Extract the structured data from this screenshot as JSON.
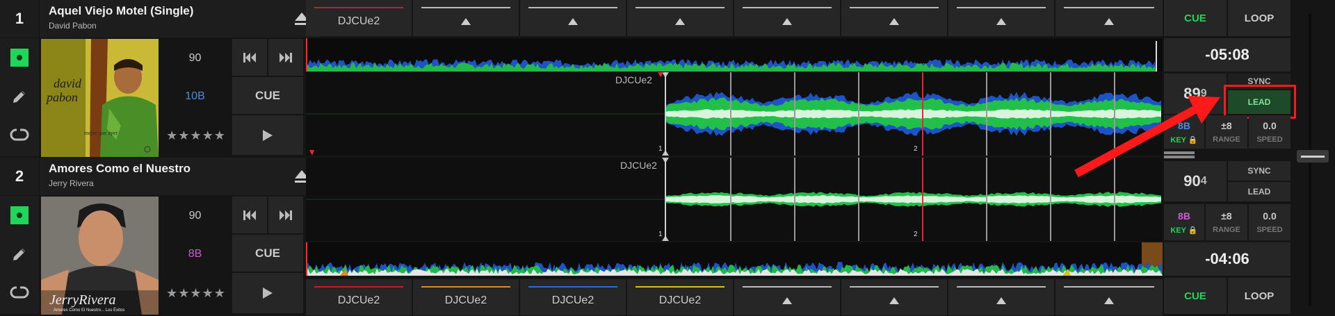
{
  "deck1": {
    "number": "1",
    "title": "Aquel Viejo Motel (Single)",
    "artist": "David Pabon",
    "bpm": "90",
    "key": "10B",
    "stars": "★★★★★",
    "cue_label": "CUE",
    "waveform_cue_label": "DJCUe2",
    "beat_marker_1": "1",
    "beat_marker_2": "2",
    "time_remaining": "-05:08",
    "bpm_display": "89",
    "bpm_decimal": "9",
    "key_display": "8B",
    "key_lock_label": "KEY",
    "range_value": "±8",
    "range_label": "RANGE",
    "speed_value": "0.0",
    "speed_label": "SPEED",
    "sync_label": "SYNC",
    "lead_label": "LEAD",
    "cue_button": "CUE",
    "loop_button": "LOOP",
    "hotcue_labels": [
      "DJCUe2",
      "",
      "",
      "",
      "",
      "",
      "",
      ""
    ]
  },
  "deck2": {
    "number": "2",
    "title": "Amores Como el Nuestro",
    "artist": "Jerry Rivera",
    "bpm": "90",
    "key": "8B",
    "stars": "★★★★★",
    "cue_label": "CUE",
    "waveform_cue_label": "DJCUe2",
    "beat_marker_1": "1",
    "beat_marker_2": "2",
    "time_remaining": "-04:06",
    "bpm_display": "90",
    "bpm_decimal": "4",
    "key_display": "8B",
    "key_lock_label": "KEY",
    "range_value": "±8",
    "range_label": "RANGE",
    "speed_value": "0.0",
    "speed_label": "SPEED",
    "sync_label": "SYNC",
    "lead_label": "LEAD",
    "cue_button": "CUE",
    "loop_button": "LOOP",
    "hotcue_labels": [
      "DJCUe2",
      "DJCUe2",
      "DJCUe2",
      "DJCUe2",
      "",
      "",
      "",
      ""
    ],
    "art_text_main": "JerryRivera",
    "art_text_sub": "Amores Como El Nuestro... Los Éxitos"
  },
  "deck1_art": {
    "name_line1": "david",
    "name_line2": "pabon",
    "tagline": "mejor que ayer"
  },
  "colors": {
    "accent_green": "#1fd65a",
    "wave_blue": "#1d53c4",
    "key_blue": "#4f88e0",
    "key_pink": "#d05ad4",
    "highlight_red": "#ff1a1a",
    "hotcue_red": "#c0202c",
    "hotcue_orange": "#e0852a",
    "hotcue_blue": "#2c6bd6",
    "hotcue_yellow": "#d6c02a"
  },
  "icons": [
    "eject-icon",
    "record-icon",
    "pencil-icon",
    "loop-icon",
    "prev-track-icon",
    "next-track-icon",
    "play-icon",
    "lock-icon",
    "arrow-annotation"
  ]
}
